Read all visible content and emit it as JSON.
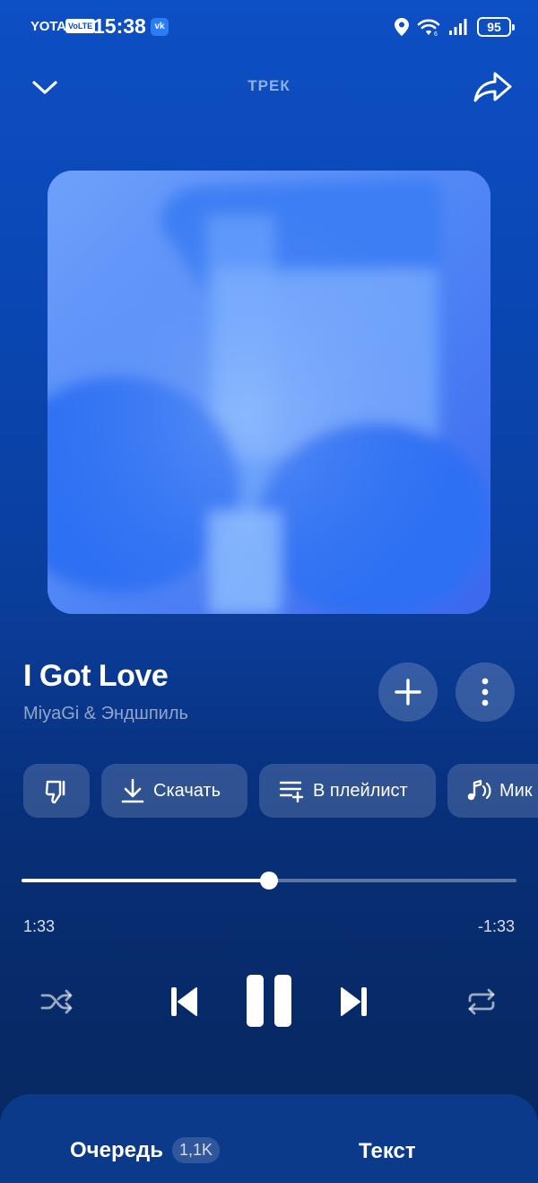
{
  "status_bar": {
    "carrier": "YOTA",
    "volte": "VoLTE",
    "time": "15:38",
    "vk_badge": "vk",
    "battery": "95",
    "icons": [
      "location-icon",
      "wifi-icon",
      "signal-icon",
      "battery-icon"
    ]
  },
  "header": {
    "title": "ТРЕК",
    "collapse_icon": "chevron-down-icon",
    "share_icon": "share-icon"
  },
  "track": {
    "title": "I Got Love",
    "artist": "MiyaGi & Эндшпиль"
  },
  "actions": {
    "dislike_icon": "dislike-icon",
    "download": "Скачать",
    "add_to_playlist": "В плейлист",
    "mix": "Мик"
  },
  "player": {
    "elapsed": "1:33",
    "remaining": "-1:33",
    "progress": 0.5
  },
  "controls": [
    "shuffle-icon",
    "previous-icon",
    "pause-icon",
    "next-icon",
    "repeat-icon"
  ],
  "bottom": {
    "queue_label": "Очередь",
    "queue_count": "1,1K",
    "lyrics_label": "Текст"
  },
  "colors": {
    "background_top": "#0d4fc4",
    "background_bottom": "#072860",
    "album_art": "#4c7ff5"
  }
}
